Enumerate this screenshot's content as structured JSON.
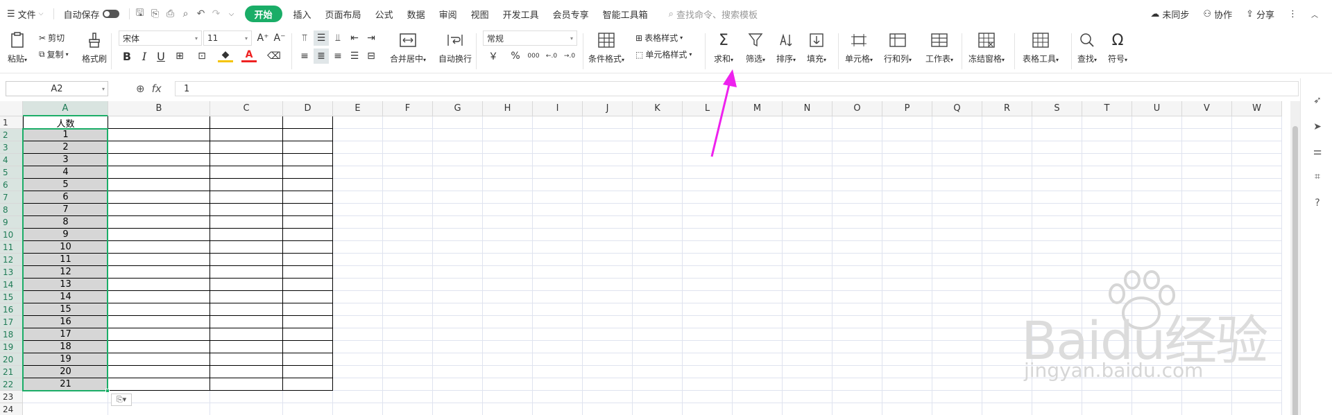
{
  "menubar": {
    "file": "文件",
    "autosave": "自动保存",
    "tabs": [
      "开始",
      "插入",
      "页面布局",
      "公式",
      "数据",
      "审阅",
      "视图",
      "开发工具",
      "会员专享",
      "智能工具箱"
    ],
    "search_placeholder": "查找命令、搜索模板",
    "sync": "未同步",
    "collab": "协作",
    "share": "分享"
  },
  "ribbon": {
    "paste": "粘贴",
    "cut": "剪切",
    "copy": "复制",
    "format_painter": "格式刷",
    "font_name": "宋体",
    "font_size": "11",
    "merge_center": "合并居中",
    "wrap_text": "自动换行",
    "number_format": "常规",
    "currency": "￥",
    "percent": "%",
    "thousands": "000",
    "cond_format": "条件格式",
    "table_style": "表格样式",
    "cell_style": "单元格样式",
    "sum": "求和",
    "filter": "筛选",
    "sort": "排序",
    "fill": "填充",
    "cell": "单元格",
    "row_col": "行和列",
    "worksheet": "工作表",
    "freeze": "冻结窗格",
    "table_tools": "表格工具",
    "find": "查找",
    "symbol": "符号"
  },
  "formula_bar": {
    "name_box": "A2",
    "fx": "fx",
    "content": "1"
  },
  "sheet": {
    "columns": [
      "A",
      "B",
      "C",
      "D",
      "E",
      "F",
      "G",
      "H",
      "I",
      "J",
      "K",
      "L",
      "M",
      "N",
      "O",
      "P",
      "Q",
      "R",
      "S",
      "T",
      "U",
      "V",
      "W"
    ],
    "rows": [
      "1",
      "2",
      "3",
      "4",
      "5",
      "6",
      "7",
      "8",
      "9",
      "10",
      "11",
      "12",
      "13",
      "14",
      "15",
      "16",
      "17",
      "18",
      "19",
      "20",
      "21",
      "22",
      "23",
      "24"
    ],
    "header_cell": "人数",
    "values": [
      "1",
      "2",
      "3",
      "4",
      "5",
      "6",
      "7",
      "8",
      "9",
      "10",
      "11",
      "12",
      "13",
      "14",
      "15",
      "16",
      "17",
      "18",
      "19",
      "20",
      "21"
    ],
    "active_column": "A"
  },
  "watermark": {
    "main": "Baidu经验",
    "sub": "jingyan.baidu.com"
  },
  "colors": {
    "accent": "#1aad67",
    "arrow": "#ee22ee",
    "selected_fill": "#d6d6d6"
  }
}
